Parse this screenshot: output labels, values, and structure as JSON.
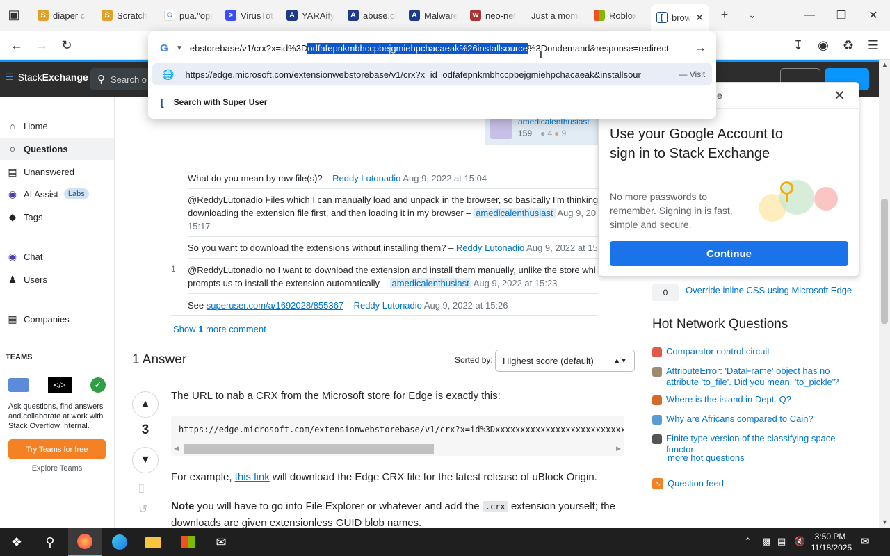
{
  "browser": {
    "tabs": [
      {
        "label": "diaper cl",
        "fav_color": "#e2a227"
      },
      {
        "label": "Scratch",
        "fav_color": "#e2a227"
      },
      {
        "label": "pua.\"ope",
        "fav_color": "#4285f4"
      },
      {
        "label": "VirusTota",
        "fav_color": "#394eff"
      },
      {
        "label": "YARAify",
        "fav_color": "#1d3a8a"
      },
      {
        "label": "abuse.ch",
        "fav_color": "#1d3a8a"
      },
      {
        "label": "Malware",
        "fav_color": "#1d3a8a"
      },
      {
        "label": "neo-net",
        "fav_color": "#a33"
      },
      {
        "label": "Just a mome",
        "fav_color": "#ccc"
      },
      {
        "label": "Roblox",
        "fav_color": "#f25022"
      },
      {
        "label": "brows",
        "fav_color": "#1e4c8f"
      }
    ],
    "url_before": "ebstorebase/v1/crx?x=id%3D",
    "url_selected": "odfafepnkmbhccpbejgmiehpchacaeak%26installsource",
    "url_after": "%3Dondemand&response=redirect",
    "suggestion_url": "https://edge.microsoft.com/extensionwebstorebase/v1/crx?x=id=odfafepnkmbhccpbejgmiehpchacaeak&installsour",
    "suggestion_action": "— Visit",
    "search_with": "Search with Super User"
  },
  "so": {
    "logo_a": "Stack",
    "logo_b": "Exchange",
    "search_placeholder": "Search o",
    "nav": {
      "home": "Home",
      "questions": "Questions",
      "unanswered": "Unanswered",
      "ai_assist": "AI Assist",
      "labs": "Labs",
      "tags": "Tags",
      "chat": "Chat",
      "users": "Users",
      "companies": "Companies",
      "teams_header": "TEAMS",
      "teams_text": "Ask questions, find answers and collaborate at work with Stack Overflow Internal.",
      "try_teams": "Try Teams for free",
      "explore_teams": "Explore Teams"
    },
    "asker": {
      "name": "amedicalenthusiast",
      "rep": "159",
      "silver": "4",
      "bronze": "9"
    },
    "comments": [
      {
        "text": "What do you mean by raw file(s)? –",
        "user": "Reddy Lutonadio",
        "date": "Aug 9, 2022 at 15:04"
      },
      {
        "text1": "@ReddyLutonadio Files which I can manually load and unpack in the browser, so basically I'm thinking o",
        "text2": "downloading the extension file first, and then loading it in my browser –",
        "user": "amedicalenthusiast",
        "date": "Aug 9, 20",
        "date2": "15:17"
      },
      {
        "text": "So you want to download the extensions without installing them? –",
        "user": "Reddy Lutonadio",
        "date": "Aug 9, 2022 at 15"
      },
      {
        "score": "1",
        "text1": "@ReddyLutonadio no I want to download the extension and install them manually, unlike the store whi",
        "text2": "prompts us to install the extension automatically –",
        "user": "amedicalenthusiast",
        "date": "Aug 9, 2022 at 15:23"
      },
      {
        "text": "See",
        "link": "superuser.com/a/1692028/855367",
        "dash": "–",
        "user": "Reddy Lutonadio",
        "date": "Aug 9, 2022 at 15:26"
      }
    ],
    "show_more_a": "Show",
    "show_more_n": "1",
    "show_more_b": "more comment",
    "answers_count": "1 Answer",
    "sorted_by": "Sorted by:",
    "sort_value": "Highest score (default)",
    "vote_score": "3",
    "answer_intro": "The URL to nab a CRX from the Microsoft store for Edge is exactly this:",
    "code": "https://edge.microsoft.com/extensionwebstorebase/v1/crx?x=id%3Dxxxxxxxxxxxxxxxxxxxxxxxxxxxxxxx",
    "example_a": "For example,",
    "example_link": "this link",
    "example_b": "will download the Edge CRX file for the latest release of uBlock Origin.",
    "note_bold": "Note",
    "note_a": "you will have to go into File Explorer or whatever and add the",
    "note_code": ".crx",
    "note_b": "extension yourself; the",
    "note_c": "downloads are given extensionless GUID blob names."
  },
  "popup": {
    "title": "Use your Google Account to sign in to Stack Exchange",
    "body": "No more passwords to remember. Signing in is fast, simple and secure.",
    "continue": "Continue",
    "header_partial": "e"
  },
  "sidebar": {
    "related_count": "0",
    "related_title": "Override inline CSS using Microsoft Edge",
    "hnq_header": "Hot Network Questions",
    "hnq": [
      {
        "title": "Comparator control circuit",
        "color": "#e05a47"
      },
      {
        "title": "AttributeError: 'DataFrame' object has no attribute 'to_file'. Did you mean: 'to_pickle'?",
        "color": "#9c8b6e"
      },
      {
        "title": "Where is the island in Dept. Q?",
        "color": "#d36b2b"
      },
      {
        "title": "Why are Africans compared to Cain?",
        "color": "#5b9bd5"
      },
      {
        "title": "Finite type version of the classifying space functor",
        "color": "#555"
      }
    ],
    "more_hnq": "more hot questions",
    "feed": "Question feed"
  },
  "taskbar": {
    "time": "3:50 PM",
    "date": "11/18/2025"
  }
}
